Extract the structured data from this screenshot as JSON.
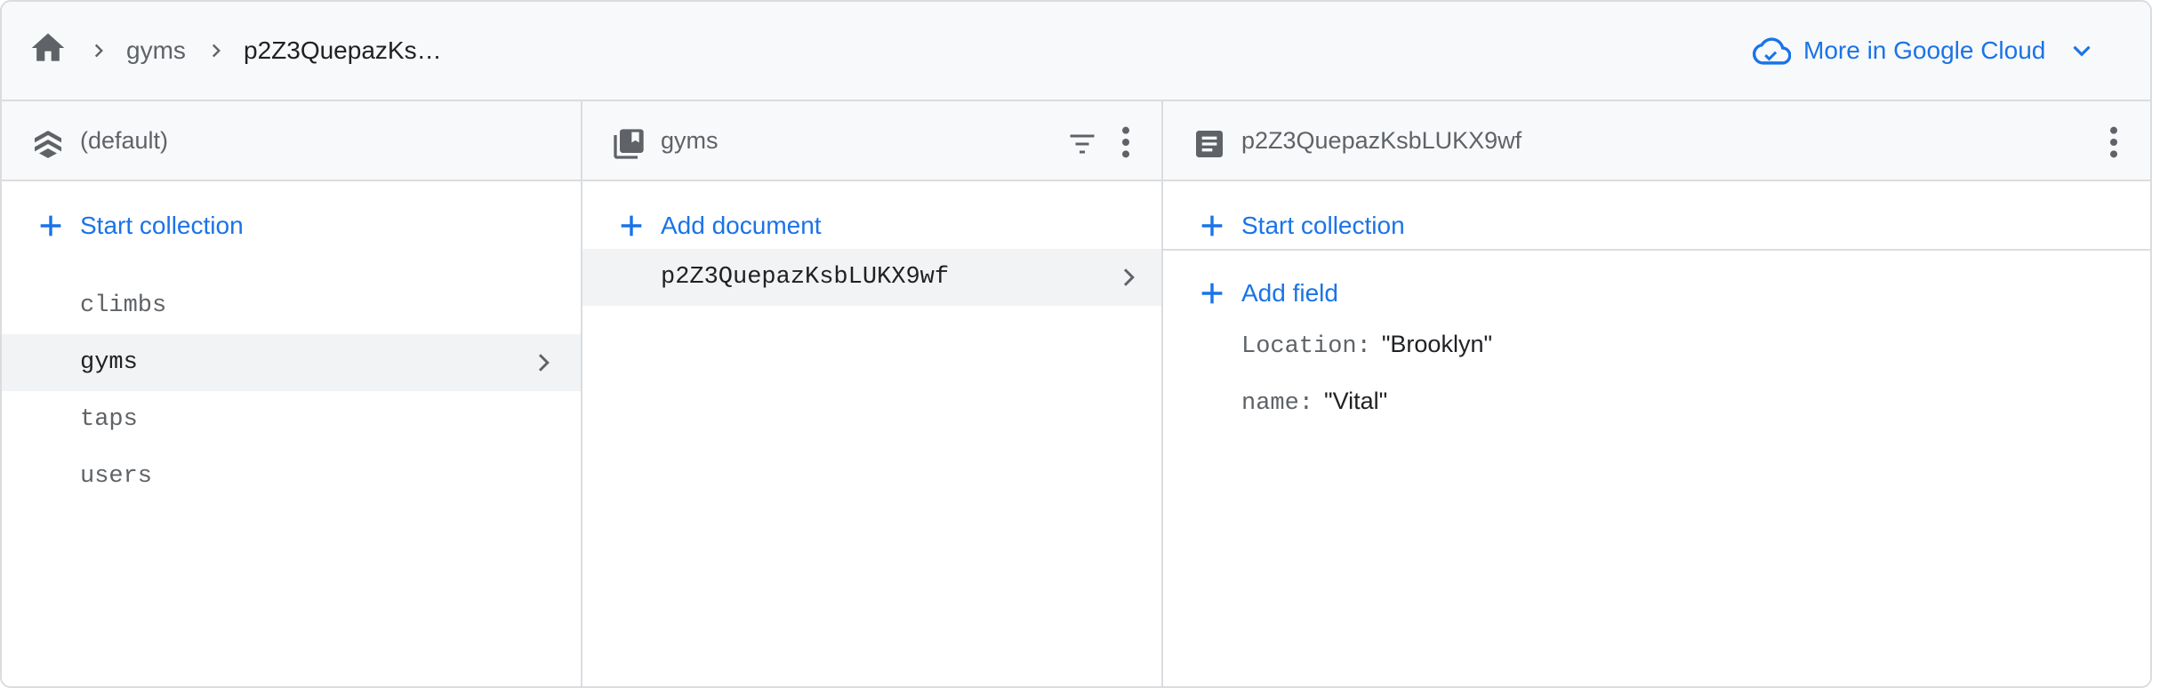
{
  "breadcrumb": {
    "home_icon": "home-icon",
    "items": [
      "gyms",
      "p2Z3QuepazKs…"
    ]
  },
  "header": {
    "cloud_link": "More in Google Cloud"
  },
  "database_panel": {
    "title": "(default)",
    "start_collection": "Start collection",
    "collections": [
      "climbs",
      "gyms",
      "taps",
      "users"
    ],
    "selected": "gyms"
  },
  "collection_panel": {
    "title": "gyms",
    "add_document": "Add document",
    "documents": [
      "p2Z3QuepazKsbLUKX9wf"
    ]
  },
  "document_panel": {
    "title": "p2Z3QuepazKsbLUKX9wf",
    "start_collection": "Start collection",
    "add_field": "Add field",
    "fields": [
      {
        "key": "Location:",
        "value": "\"Brooklyn\""
      },
      {
        "key": "name:",
        "value": "\"Vital\""
      }
    ]
  },
  "colors": {
    "accent": "#1a73e8",
    "border": "#dadce0",
    "header_bg": "#f8f9fa",
    "selected_bg": "#f1f3f4"
  }
}
